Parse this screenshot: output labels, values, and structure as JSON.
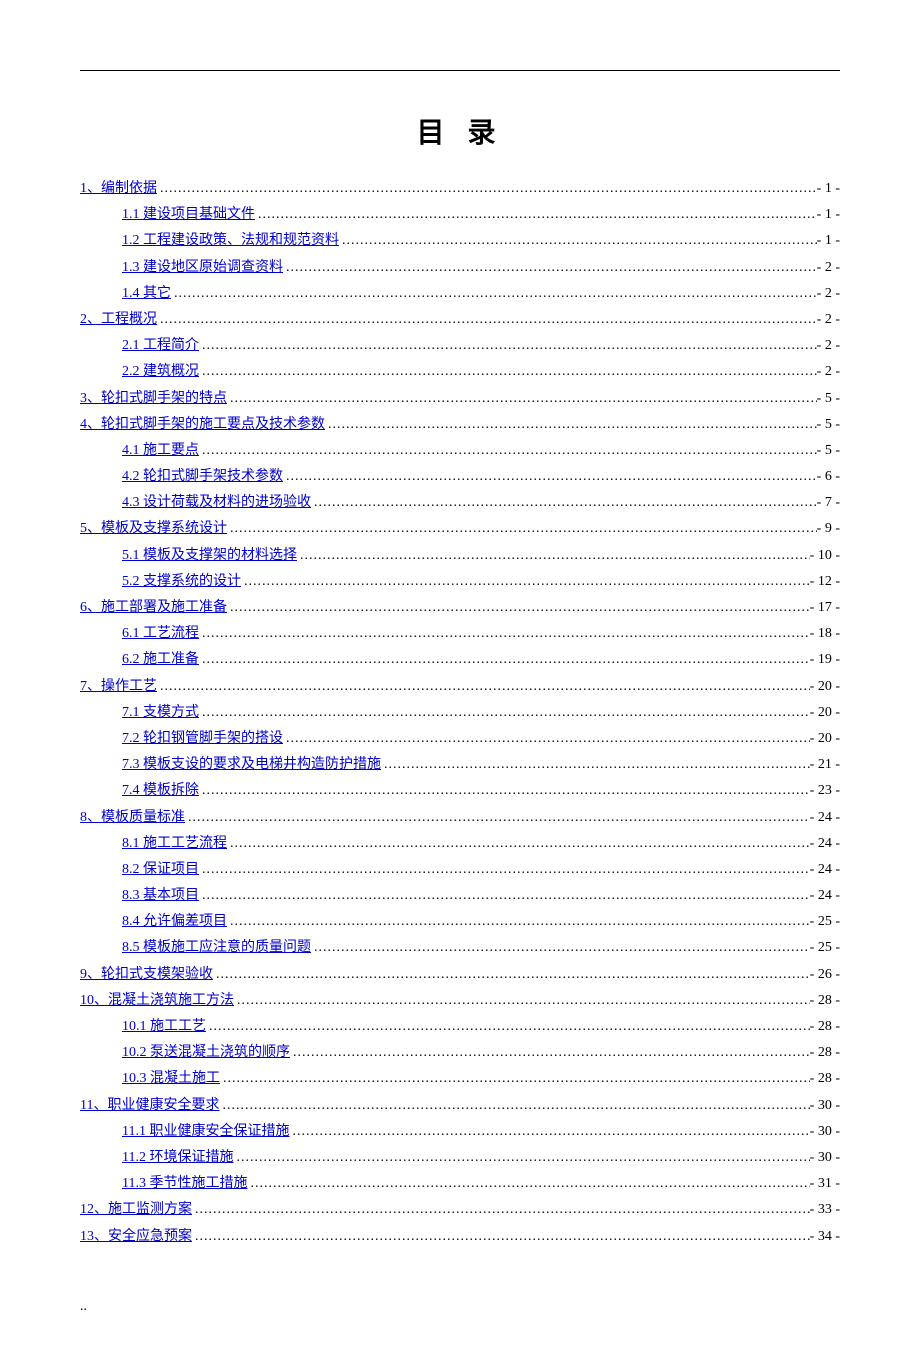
{
  "title": "目 录",
  "footer": "..",
  "toc": [
    {
      "level": 1,
      "text": "1、编制依据",
      "page": "- 1 -"
    },
    {
      "level": 2,
      "text": "1.1 建设项目基础文件",
      "page": "- 1 -"
    },
    {
      "level": 2,
      "text": "1.2 工程建设政策、法规和规范资料",
      "page": "- 1 -"
    },
    {
      "level": 2,
      "text": "1.3 建设地区原始调查资料",
      "page": "- 2 -"
    },
    {
      "level": 2,
      "text": "1.4 其它",
      "page": "- 2 -"
    },
    {
      "level": 1,
      "text": "2、工程概况",
      "page": "- 2 -"
    },
    {
      "level": 2,
      "text": "2.1 工程简介",
      "page": "- 2 -"
    },
    {
      "level": 2,
      "text": "2.2 建筑概况",
      "page": "- 2 -"
    },
    {
      "level": 1,
      "text": "3、轮扣式脚手架的特点",
      "page": "- 5 -"
    },
    {
      "level": 1,
      "text": "4、轮扣式脚手架的施工要点及技术参数",
      "page": "- 5 -"
    },
    {
      "level": 2,
      "text": "4.1 施工要点",
      "page": "- 5 -"
    },
    {
      "level": 2,
      "text": "4.2 轮扣式脚手架技术参数",
      "page": "- 6 -"
    },
    {
      "level": 2,
      "text": "4.3 设计荷载及材料的进场验收",
      "page": "- 7 -"
    },
    {
      "level": 1,
      "text": "5、模板及支撑系统设计",
      "page": "- 9 -"
    },
    {
      "level": 2,
      "text": "5.1 模板及支撑架的材料选择",
      "page": "- 10 -"
    },
    {
      "level": 2,
      "text": "5.2 支撑系统的设计",
      "page": "- 12 -"
    },
    {
      "level": 1,
      "text": "6、施工部署及施工准备",
      "page": "- 17 -"
    },
    {
      "level": 2,
      "text": "6.1 工艺流程",
      "page": "- 18 -"
    },
    {
      "level": 2,
      "text": "6.2 施工准备",
      "page": "- 19 -"
    },
    {
      "level": 1,
      "text": "7、操作工艺",
      "page": "- 20 -"
    },
    {
      "level": 2,
      "text": "7.1 支模方式",
      "page": "- 20 -"
    },
    {
      "level": 2,
      "text": "7.2 轮扣钢管脚手架的搭设",
      "page": "- 20 -"
    },
    {
      "level": 2,
      "text": "7.3 模板支设的要求及电梯井构造防护措施",
      "page": "- 21 -"
    },
    {
      "level": 2,
      "text": "7.4 模板拆除",
      "page": "- 23 -"
    },
    {
      "level": 1,
      "text": "8、模板质量标准",
      "page": "- 24 -"
    },
    {
      "level": 2,
      "text": "8.1 施工工艺流程",
      "page": "- 24 -"
    },
    {
      "level": 2,
      "text": "8.2 保证项目",
      "page": "- 24 -"
    },
    {
      "level": 2,
      "text": "8.3 基本项目",
      "page": "- 24 -"
    },
    {
      "level": 2,
      "text": "8.4 允许偏差项目",
      "page": "- 25 -"
    },
    {
      "level": 2,
      "text": "8.5 模板施工应注意的质量问题",
      "page": "- 25 -"
    },
    {
      "level": 1,
      "text": "9、轮扣式支模架验收",
      "page": "- 26 -"
    },
    {
      "level": 1,
      "text": "10、混凝土浇筑施工方法",
      "page": "- 28 -"
    },
    {
      "level": 2,
      "text": "10.1 施工工艺",
      "page": "- 28 -"
    },
    {
      "level": 2,
      "text": "10.2 泵送混凝土浇筑的顺序",
      "page": "- 28 -"
    },
    {
      "level": 2,
      "text": "10.3 混凝土施工",
      "page": "- 28 -"
    },
    {
      "level": 1,
      "text": "11、职业健康安全要求",
      "page": "- 30 -"
    },
    {
      "level": 2,
      "text": "11.1 职业健康安全保证措施",
      "page": "- 30 -"
    },
    {
      "level": 2,
      "text": "11.2 环境保证措施",
      "page": "- 30 -"
    },
    {
      "level": 2,
      "text": "11.3 季节性施工措施",
      "page": "- 31 -"
    },
    {
      "level": 1,
      "text": "12、施工监测方案",
      "page": "- 33 -"
    },
    {
      "level": 1,
      "text": "13、安全应急预案",
      "page": "- 34 -"
    }
  ]
}
